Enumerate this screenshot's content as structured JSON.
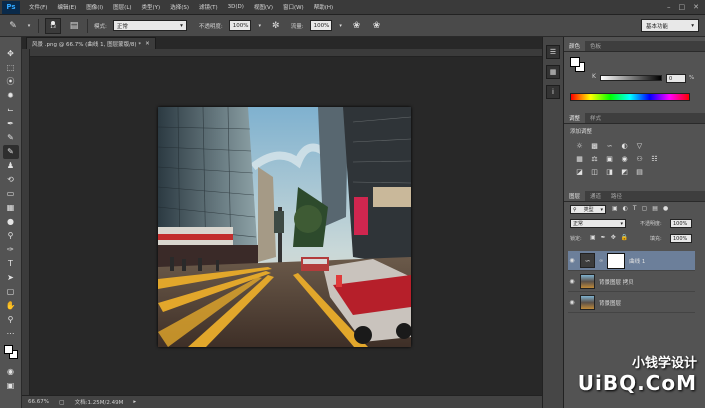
{
  "app": {
    "logo": "Ps"
  },
  "menu": {
    "items": [
      "文件(F)",
      "编辑(E)",
      "图像(I)",
      "图层(L)",
      "类型(Y)",
      "选择(S)",
      "滤镜(T)",
      "3D(D)",
      "视图(V)",
      "窗口(W)",
      "帮助(H)"
    ]
  },
  "options": {
    "brush_size": "13",
    "mode_label": "模式:",
    "mode_value": "正常",
    "opacity_label": "不透明度:",
    "opacity_value": "100%",
    "flow_label": "流量:",
    "flow_value": "100%",
    "workspace": "基本功能"
  },
  "document": {
    "tab_title": "风景 .png @ 66.7% (曲线 1, 图层蒙版/8) *",
    "zoom": "66.67%",
    "doc_info": "文档:1.25M/2.49M"
  },
  "panels": {
    "color": {
      "tabs": [
        "颜色",
        "色板"
      ],
      "k_label": "K",
      "k_value": "0",
      "k_unit": "%"
    },
    "adjustments": {
      "tabs": [
        "调整",
        "样式"
      ],
      "add_label": "添加调整"
    },
    "layers": {
      "tabs": [
        "图层",
        "通道",
        "路径"
      ],
      "filter": "类型",
      "blend_mode": "正常",
      "opacity_label": "不透明度:",
      "opacity_value": "100%",
      "lock_label": "锁定:",
      "fill_label": "填充:",
      "fill_value": "100%",
      "items": [
        {
          "name": "曲线 1",
          "selected": true
        },
        {
          "name": "背景图层 拷贝",
          "selected": false
        },
        {
          "name": "背景图层",
          "selected": false
        }
      ]
    }
  },
  "watermark": {
    "line1": "小钱学设计",
    "line2": "UiBQ.CoM"
  },
  "colors": {
    "accent": "#31a8ff",
    "layer_selected": "#6c7f9a"
  }
}
